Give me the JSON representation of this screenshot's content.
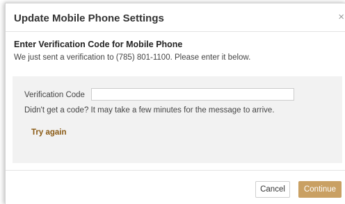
{
  "dialog": {
    "title": "Update Mobile Phone Settings",
    "close_icon": "close-icon",
    "close_glyph": "×"
  },
  "verification": {
    "heading": "Enter Verification Code for Mobile Phone",
    "description": "We just sent a verification to (785) 801-1100. Please enter it below.",
    "field_label": "Verification Code",
    "field_value": "",
    "hint": "Didn't get a code? It may take a few minutes for the message to arrive.",
    "try_again_label": "Try again"
  },
  "footer": {
    "cancel_label": "Cancel",
    "continue_label": "Continue"
  },
  "colors": {
    "accent": "#c9a063",
    "link": "#8a5a14",
    "panel_bg": "#f2f2f2"
  }
}
